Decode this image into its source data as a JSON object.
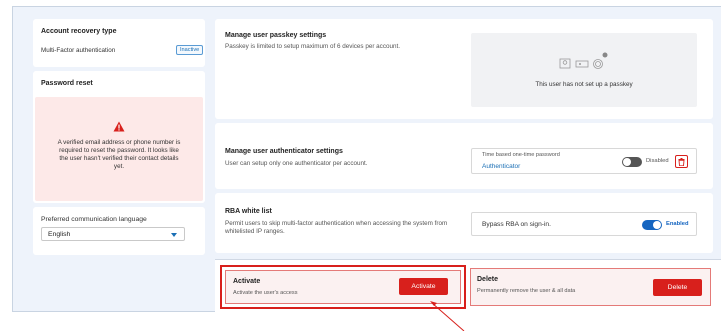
{
  "left": {
    "recovery": {
      "title": "Account recovery type",
      "method": "Multi-Factor authentication",
      "status": "Inactive"
    },
    "password_reset": {
      "title": "Password reset",
      "warning": "A verified email address or phone number is required to reset the password. It looks like the user hasn't verified their contact details yet."
    },
    "language": {
      "label": "Preferred communication language",
      "value": "English"
    }
  },
  "passkey": {
    "title": "Manage user passkey settings",
    "description": "Passkey is limited to setup maximum of 6 devices per account.",
    "empty_text": "This user has not set up a passkey"
  },
  "authenticator": {
    "title": "Manage user authenticator settings",
    "description": "User can setup only one authenticator per account.",
    "method_label": "Time based one-time password",
    "method_link": "Authenticator",
    "state": "Disabled"
  },
  "rba": {
    "title": "RBA white list",
    "description": "Permit users to skip multi-factor authentication when accessing the system from whitelisted IP ranges.",
    "option": "Bypass RBA on sign-in.",
    "state": "Enabled"
  },
  "activate": {
    "title": "Activate",
    "description": "Activate the user's access",
    "button": "Activate"
  },
  "delete": {
    "title": "Delete",
    "description": "Permanently remove the user & all data",
    "button": "Delete"
  },
  "colors": {
    "accent": "#1a6fb5",
    "danger": "#d8201c",
    "toggle_on": "#1565c0",
    "toggle_off": "#555555",
    "warning_bg": "#fde9e8"
  }
}
